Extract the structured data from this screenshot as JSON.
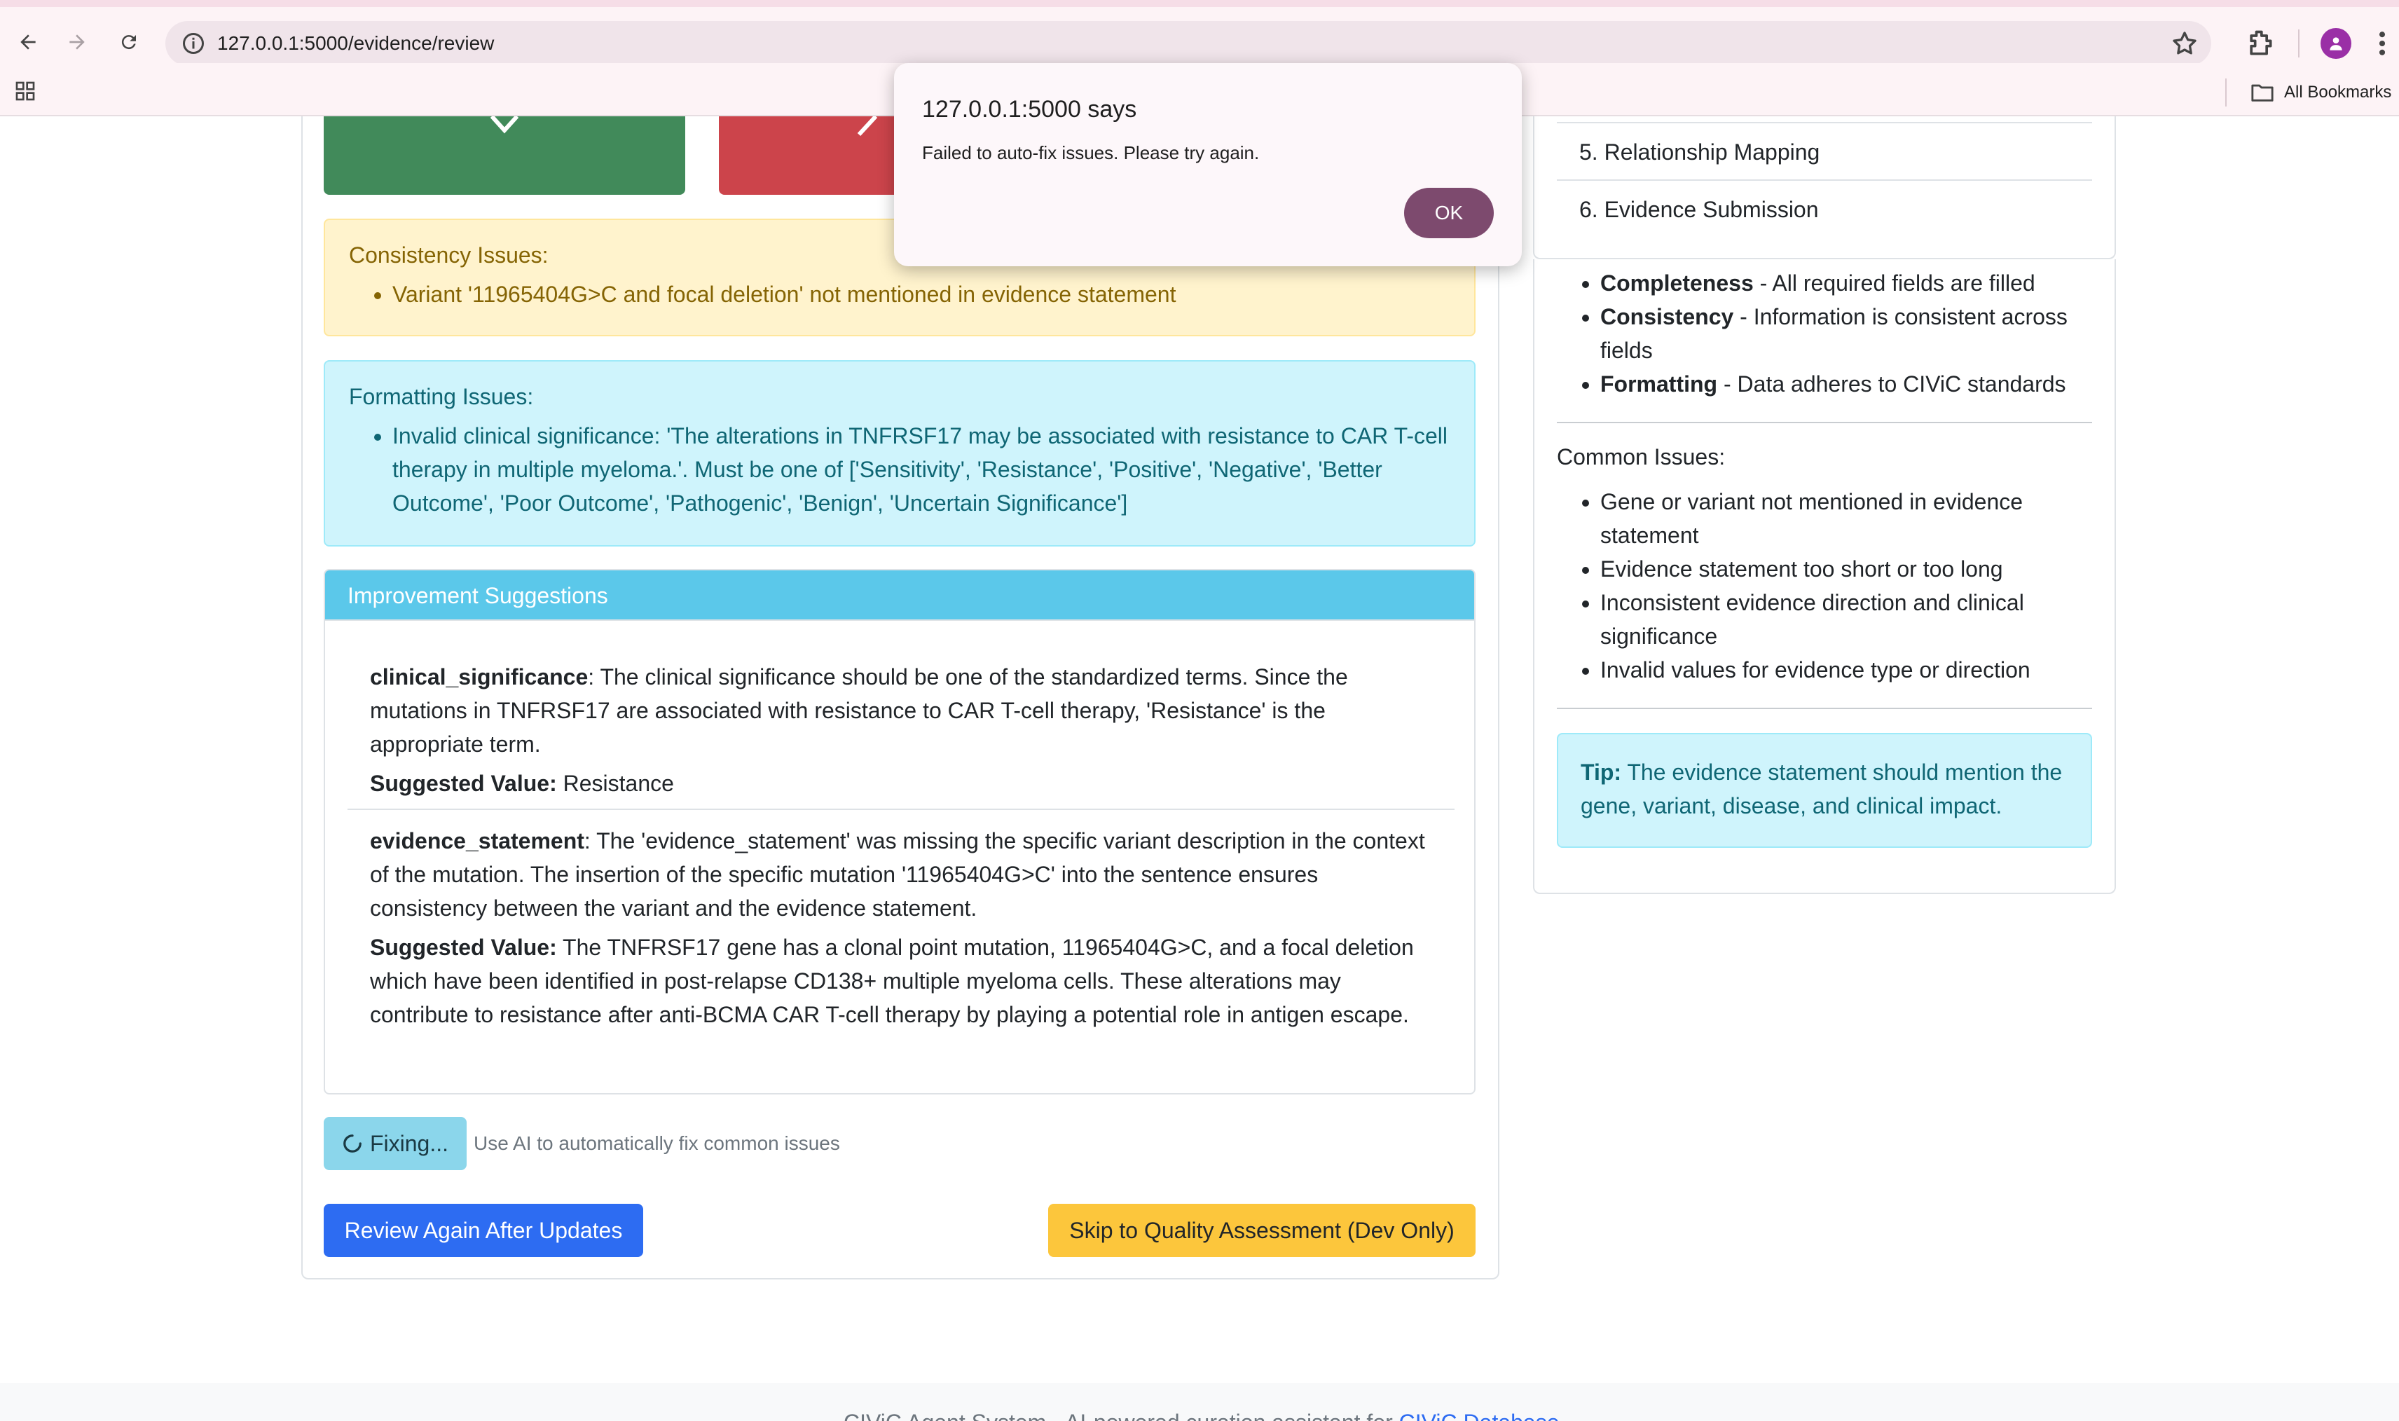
{
  "browser": {
    "url": "127.0.0.1:5000/evidence/review",
    "bookmarks_label": "All Bookmarks"
  },
  "dialog": {
    "title": "127.0.0.1:5000 says",
    "message": "Failed to auto-fix issues. Please try again.",
    "ok_label": "OK"
  },
  "consistency": {
    "title": "Consistency Issues:",
    "items": [
      "Variant '11965404G>C and focal deletion' not mentioned in evidence statement"
    ]
  },
  "formatting": {
    "title": "Formatting Issues:",
    "items": [
      "Invalid clinical significance: 'The alterations in TNFRSF17 may be associated with resistance to CAR T-cell therapy in multiple myeloma.'. Must be one of ['Sensitivity', 'Resistance', 'Positive', 'Negative', 'Better Outcome', 'Poor Outcome', 'Pathogenic', 'Benign', 'Uncertain Significance']"
    ]
  },
  "suggestions": {
    "header": "Improvement Suggestions",
    "suggested_label": "Suggested Value:",
    "items": [
      {
        "field": "clinical_significance",
        "reason": ": The clinical significance should be one of the standardized terms. Since the mutations in TNFRSF17 are associated with resistance to CAR T-cell therapy, 'Resistance' is the appropriate term.",
        "value": "Resistance"
      },
      {
        "field": "evidence_statement",
        "reason": ": The 'evidence_statement' was missing the specific variant description in the context of the mutation. The insertion of the specific mutation '11965404G>C' into the sentence ensures consistency between the variant and the evidence statement.",
        "value": "The TNFRSF17 gene has a clonal point mutation, 11965404G>C, and a focal deletion which have been identified in post-relapse CD138+ multiple myeloma cells. These alterations may contribute to resistance after anti-BCMA CAR T-cell therapy by playing a potential role in antigen escape."
      }
    ]
  },
  "actions": {
    "fixing_label": "Fixing...",
    "fix_hint": "Use AI to automatically fix common issues",
    "review_again_label": "Review Again After Updates",
    "skip_label": "Skip to Quality Assessment (Dev Only)"
  },
  "sidebar": {
    "steps": [
      "5. Relationship Mapping",
      "6. Evidence Submission"
    ],
    "checks": [
      {
        "term": "Completeness",
        "desc": " - All required fields are filled"
      },
      {
        "term": "Consistency",
        "desc": " - Information is consistent across fields"
      },
      {
        "term": "Formatting",
        "desc": " - Data adheres to CIViC standards"
      }
    ],
    "common_title": "Common Issues:",
    "common_items": [
      "Gene or variant not mentioned in evidence statement",
      "Evidence statement too short or too long",
      "Inconsistent evidence direction and clinical significance",
      "Invalid values for evidence type or direction"
    ],
    "tip_label": "Tip:",
    "tip_text": " The evidence statement should mention the gene, variant, disease, and clinical impact."
  },
  "footer": {
    "text": "CIViC Agent System - AI-powered curation assistant for ",
    "link": "CIViC Database"
  },
  "colors": {
    "accept": "#418a5a",
    "reject": "#cc444b",
    "primary": "#2d6cf2",
    "warning": "#fcc63c",
    "info_header": "#5bc8ea",
    "dialog_ok": "#7d4a6e"
  }
}
